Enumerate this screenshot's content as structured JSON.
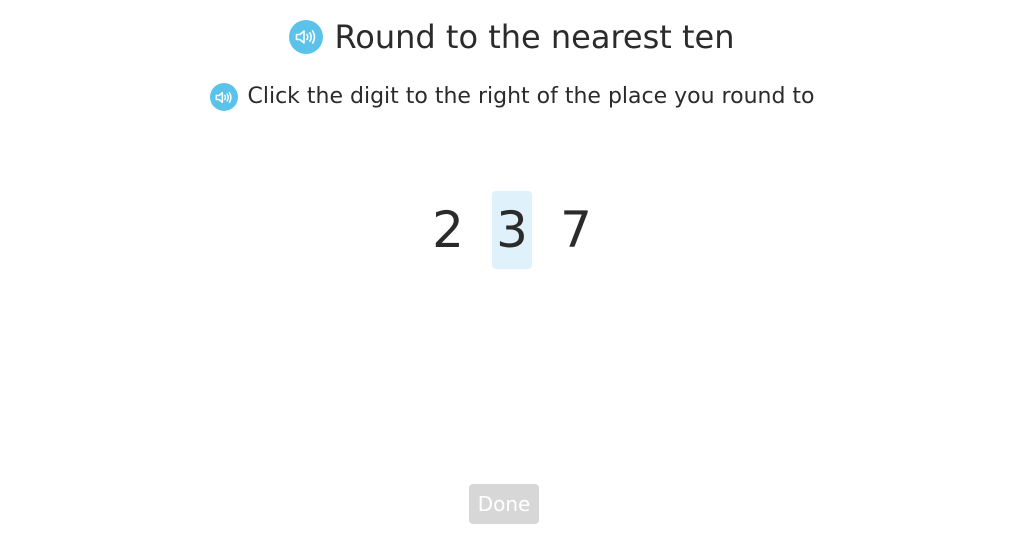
{
  "header": {
    "title": "Round to the nearest ten",
    "audio_icon": "speaker-icon"
  },
  "instruction": {
    "text": "Click the digit to the right of the place you round to",
    "audio_icon": "speaker-icon"
  },
  "number": {
    "digits": [
      "2",
      "3",
      "7"
    ],
    "selected_index": 1
  },
  "footer": {
    "done_label": "Done",
    "done_enabled": false
  },
  "colors": {
    "speaker_bg": "#5bc3e9",
    "selected_digit_bg": "#dff1fb",
    "done_disabled_bg": "#d7d7d7"
  }
}
